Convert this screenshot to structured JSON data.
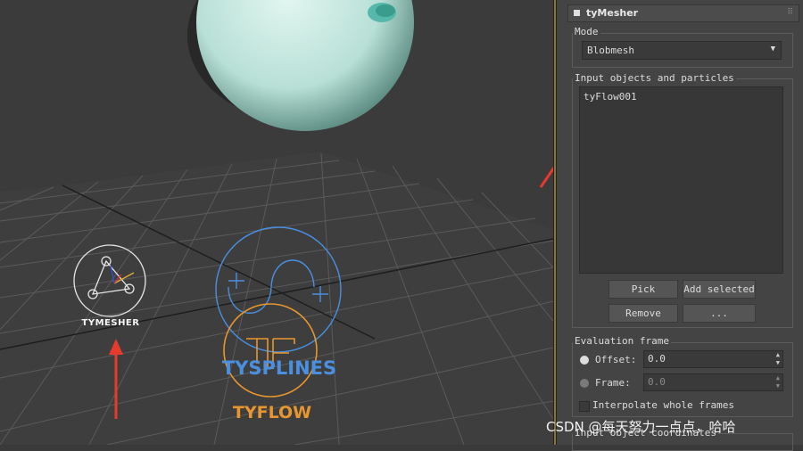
{
  "viewport": {
    "helpers": {
      "tymesher_label": "TYMESHER",
      "tysplines_label": "TYSPLINES",
      "tyflow_label": "TYFLOW"
    }
  },
  "panel": {
    "rollout_title": "tyMesher",
    "mode": {
      "label": "Mode",
      "selected": "Blobmesh"
    },
    "inputs": {
      "label": "Input objects and particles",
      "items": [
        "tyFlow001"
      ],
      "pick_label": "Pick",
      "add_selected_label": "Add selected",
      "remove_label": "Remove",
      "more_label": "..."
    },
    "evaluation": {
      "label": "Evaluation frame",
      "offset_label": "Offset:",
      "offset_value": "0.0",
      "frame_label": "Frame:",
      "frame_value": "0.0",
      "interpolate_label": "Interpolate whole frames"
    },
    "next_group_label": "Input object coordinates"
  },
  "watermark": "CSDN @每天努力一点点，哈哈",
  "colors": {
    "arrow": "#e63a2e",
    "tyflow": "#e8972e",
    "tysplines": "#4a8fe0",
    "sphere": "#cfeee6"
  }
}
